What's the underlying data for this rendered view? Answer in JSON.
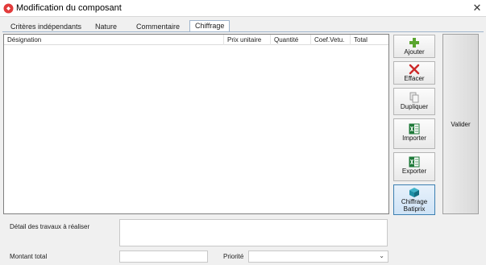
{
  "window": {
    "title": "Modification du composant",
    "close_glyph": "✕"
  },
  "tabs": [
    {
      "label": "Critères indépendants"
    },
    {
      "label": "Nature"
    },
    {
      "label": "Commentaire"
    },
    {
      "label": "Chiffrage",
      "active": true
    }
  ],
  "grid": {
    "columns": [
      "Désignation",
      "Prix unitaire",
      "Quantité",
      "Coef.Vetu.",
      "Total"
    ],
    "rows": []
  },
  "actions": [
    {
      "label": "Ajouter",
      "icon": "add-icon"
    },
    {
      "label": "Effacer",
      "icon": "delete-icon"
    },
    {
      "label": "Dupliquer",
      "icon": "duplicate-icon"
    },
    {
      "label": "Importer",
      "icon": "excel-import-icon"
    },
    {
      "label": "Exporter",
      "icon": "excel-export-icon"
    },
    {
      "label_line1": "Chiffrage",
      "label_line2": "Batiprix",
      "icon": "cube-icon"
    }
  ],
  "valider": {
    "label": "Valider"
  },
  "form": {
    "detail_label": "Détail des travaux à réaliser",
    "detail_value": "",
    "montant_label": "Montant total",
    "montant_value": "",
    "priorite_label": "Priorité",
    "priorite_value": ""
  },
  "colors": {
    "accent": "#3c7fb1",
    "add_green": "#5aa52f",
    "delete_red": "#cc2a2a",
    "excel_green": "#1f7a3a",
    "cube_teal": "#1d8fa6"
  }
}
